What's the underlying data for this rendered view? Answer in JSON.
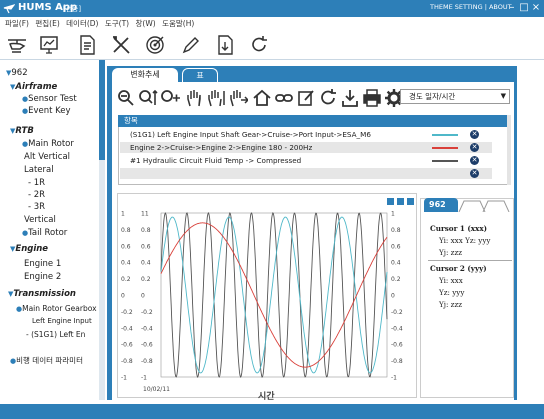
{
  "title_bar": {
    "app_name": "HUMS App",
    "app_sub": "- [전동]",
    "links": "THEME SETTING | ABOUT"
  },
  "menu": [
    "파일(F)",
    "편집(E)",
    "데이터(D)",
    "도구(T)",
    "창(W)",
    "도움말(H)"
  ],
  "toolbar_icons": [
    "helicopter-icon",
    "monitor-icon",
    "document-icon",
    "tools-icon",
    "target-icon",
    "pen-icon",
    "download-icon",
    "refresh-icon"
  ],
  "sidebar": {
    "root": "962",
    "items": [
      {
        "label": "Airframe",
        "kind": "group"
      },
      {
        "label": "Sensor Test",
        "kind": "leaf"
      },
      {
        "label": "Event Key",
        "kind": "leaf"
      },
      {
        "label": "RTB",
        "kind": "group"
      },
      {
        "label": "Main Rotor",
        "kind": "leaf"
      },
      {
        "label": "Alt Vertical",
        "kind": "plain"
      },
      {
        "label": "Lateral",
        "kind": "plain"
      },
      {
        "label": "- 1R",
        "kind": "plain"
      },
      {
        "label": "- 2R",
        "kind": "plain"
      },
      {
        "label": "- 3R",
        "kind": "plain"
      },
      {
        "label": "Vertical",
        "kind": "plain"
      },
      {
        "label": "Tail Rotor",
        "kind": "leaf"
      },
      {
        "label": "Engine",
        "kind": "group"
      },
      {
        "label": "Engine 1",
        "kind": "plain"
      },
      {
        "label": "Engine 2",
        "kind": "plain"
      },
      {
        "label": "Transmission",
        "kind": "group"
      },
      {
        "label": "Main Rotor Gearbox",
        "kind": "leaf"
      },
      {
        "label": "Left Engine Input",
        "kind": "plain"
      },
      {
        "label": "- (S1G1) Left En",
        "kind": "plain"
      },
      {
        "label": "비행 데이터 파라미터",
        "kind": "leaf"
      }
    ]
  },
  "tabs": {
    "active": "변화추세",
    "second": "표"
  },
  "range_select": {
    "value": "경도 일자/시간"
  },
  "table": {
    "header": "항목",
    "rows": [
      {
        "text": "(S1G1) Left Engine Input Shaft Gear->Cruise->Port Input->ESA_M6",
        "color": "#4fb8c9"
      },
      {
        "text": "Engine 2->Cruise->Engine 2->Engine 180 - 200Hz",
        "color": "#d9403a"
      },
      {
        "text": "#1 Hydraulic Circuit Fluid Temp -> Compressed",
        "color": "#555555"
      },
      {
        "text": "",
        "color": ""
      }
    ]
  },
  "chart_data": {
    "type": "line",
    "x_label": "시간",
    "date_label": "10/02/11",
    "left_ticks": [
      "1",
      "0.8",
      "0.6",
      "0.4",
      "0.2",
      "0",
      "-0.2",
      "-0.4",
      "-0.6",
      "-0.8",
      "-1"
    ],
    "mid_ticks": [
      "11",
      "0.8",
      "0.6",
      "0.4",
      "0.2",
      "0",
      "-0.2",
      "-0.4",
      "-0.6",
      "-0.8",
      "-1"
    ],
    "right_ticks": [
      "1",
      "0.8",
      "0.6",
      "0.4",
      "0.2",
      "0",
      "-0.2",
      "-0.4",
      "-0.6",
      "-0.8",
      "-1"
    ],
    "ylim": [
      -1,
      1
    ],
    "series": [
      {
        "color": "#555555",
        "cycles": 10.5,
        "amp": 1.0
      },
      {
        "color": "#4fb8c9",
        "cycles": 4,
        "amp": 0.95
      },
      {
        "color": "#d9403a",
        "cycles": 1.1,
        "amp": 0.88
      }
    ]
  },
  "cursor_panel": {
    "tab": "962",
    "cursor1": {
      "title": "Cursor 1 (xxx)",
      "l1": "Yi: xxx Yz: yyy",
      "l2": "Yj: zzz"
    },
    "cursor2": {
      "title": "Cursor 2 (yyy)",
      "l1": "Yi: xxx",
      "l2": "Yz: yyy",
      "l3": "Yj: zzz"
    }
  }
}
